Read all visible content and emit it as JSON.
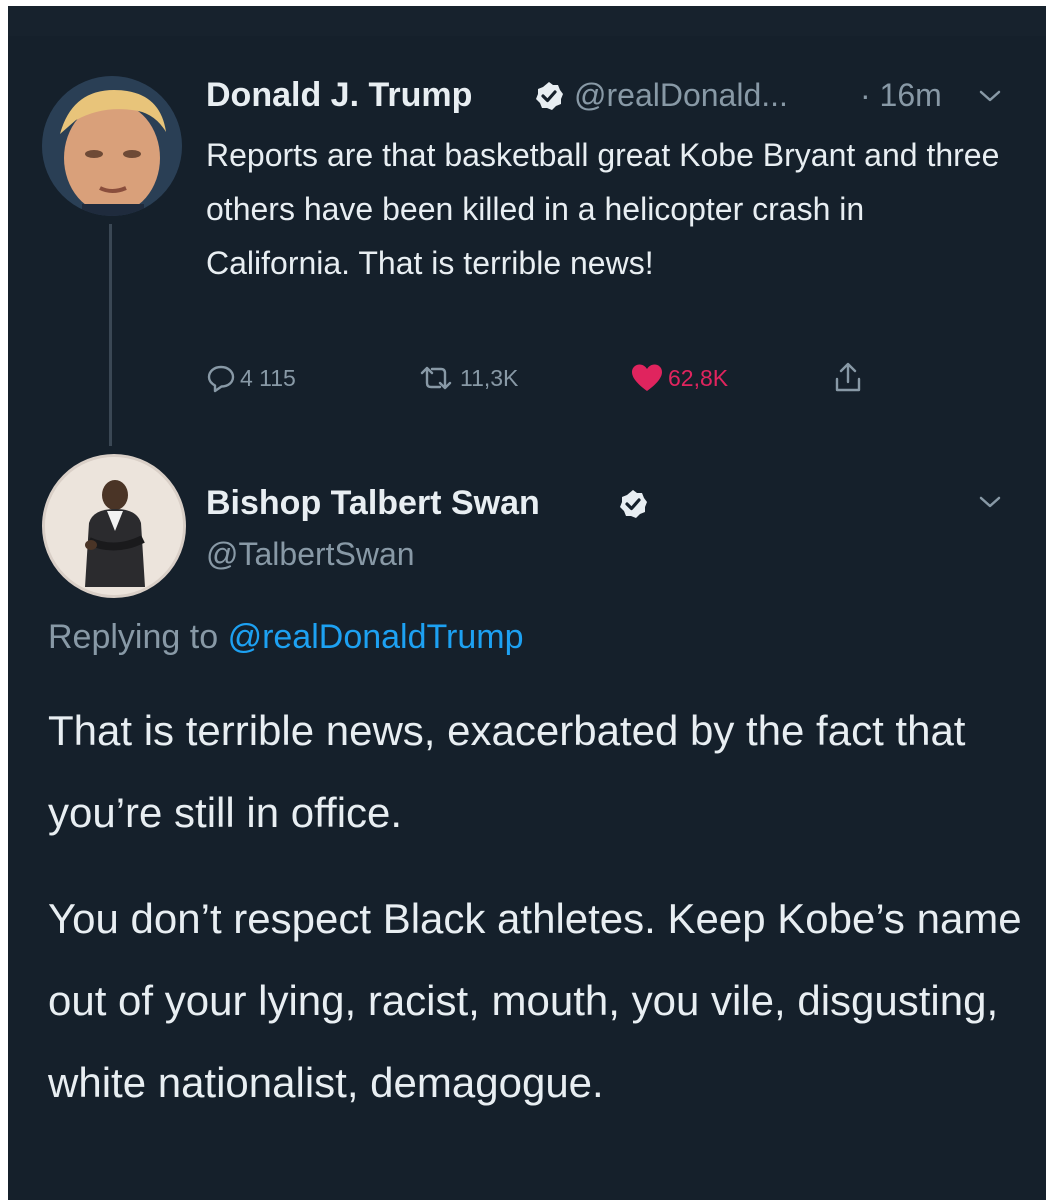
{
  "colors": {
    "background": "#15202b",
    "text": "#e8eef2",
    "muted": "#8899a6",
    "link": "#1da1f2",
    "like": "#e0245e"
  },
  "tweet": {
    "author_name": "Donald J. Trump",
    "handle": "@realDonald...",
    "time": "· 16m",
    "text": "Reports are that basketball great Kobe Bryant and three others have been killed in a helicopter crash in California. That is terrible news!",
    "reply_count": "4 115",
    "retweet_count": "11,3K",
    "like_count": "62,8K",
    "icons": [
      "verified-icon",
      "chevron-down-icon",
      "reply-icon",
      "retweet-icon",
      "heart-icon",
      "share-icon"
    ]
  },
  "reply": {
    "author_name": "Bishop Talbert Swan",
    "handle": "@TalbertSwan",
    "replying_prefix": "Replying to",
    "replying_mention": "@realDonaldTrump",
    "paragraph_1": "That is terrible news, exacerbated by the fact that you’re still in office.",
    "paragraph_2": "You don’t respect Black athletes. Keep Kobe’s name out of your lying, racist, mouth, you vile, disgusting, white nationalist, demagogue."
  }
}
